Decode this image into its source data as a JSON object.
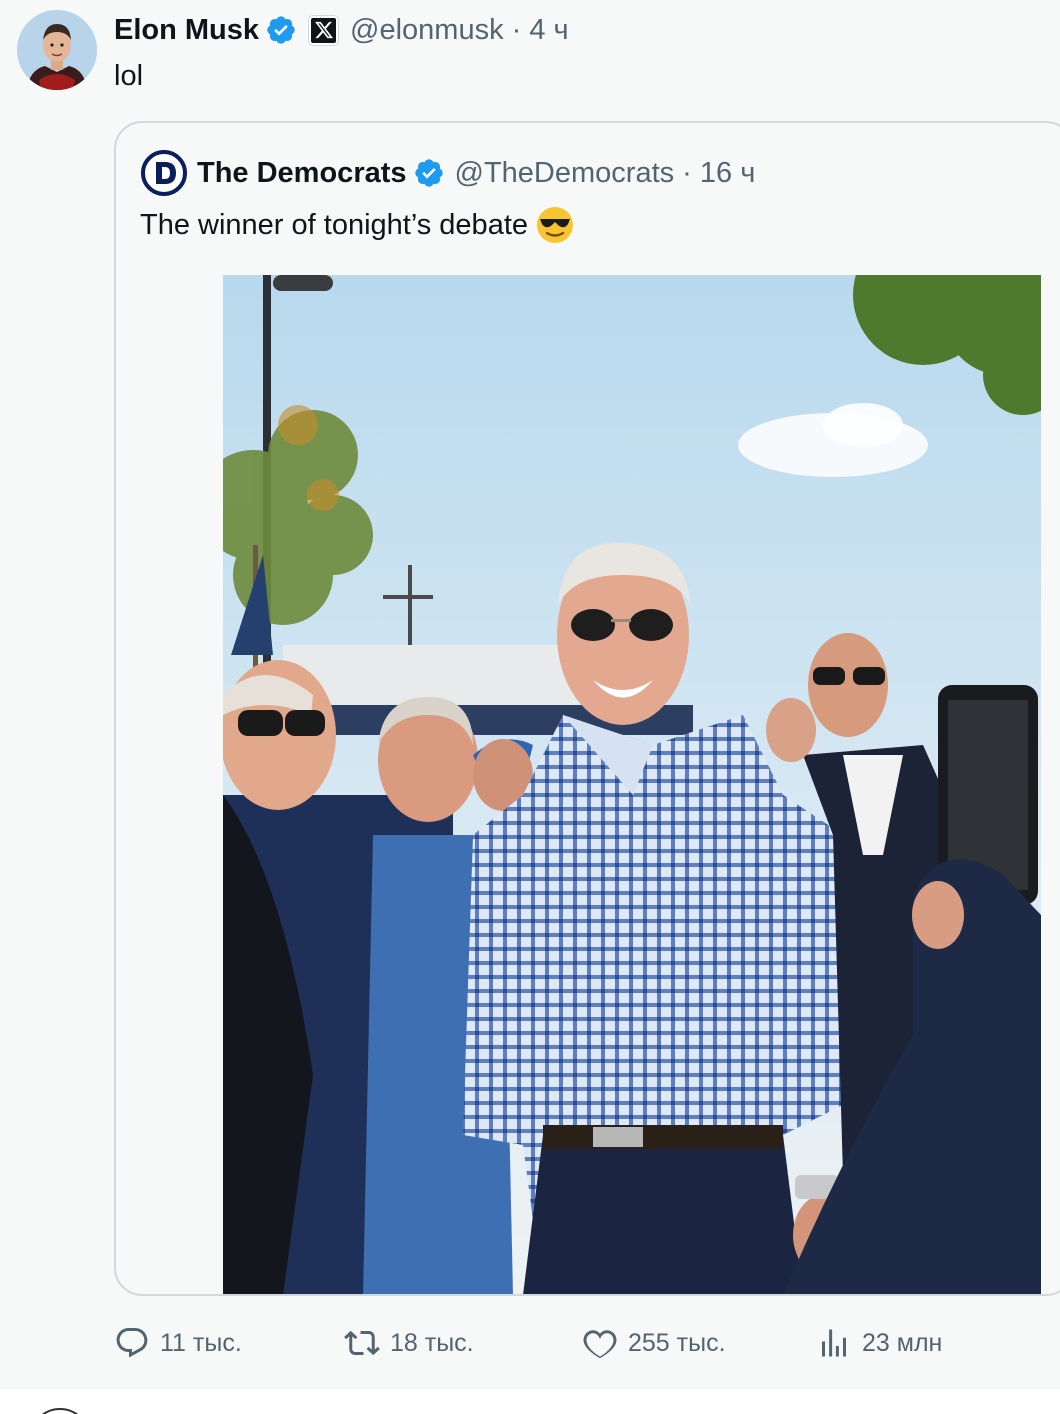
{
  "tweet": {
    "author_name": "Elon Musk",
    "author_handle_meta": "@elonmusk · 4 ч",
    "text": "lol",
    "avatar_icon": "elon-avatar",
    "verified_icon": "verified-badge-icon",
    "affiliation_icon": "x-logo-icon"
  },
  "quote": {
    "author_name": "The Democrats",
    "author_handle_meta": "@TheDemocrats · 16 ч",
    "text": "The winner of tonight’s debate",
    "emoji": "sunglasses-emoji",
    "logo_icon": "democrats-logo",
    "image": "photo-biden-smiling-in-sunglasses-crowd"
  },
  "actions": {
    "replies": "11 тыс.",
    "reposts": "18 тыс.",
    "likes": "255 тыс.",
    "views": "23 млн"
  },
  "colors": {
    "background": "#f7f9f9",
    "text": "#0f1419",
    "secondary": "#536471",
    "verified_blue": "#1d9bf0",
    "democrats_navy": "#0b1f5c",
    "border": "#cfd9de"
  }
}
